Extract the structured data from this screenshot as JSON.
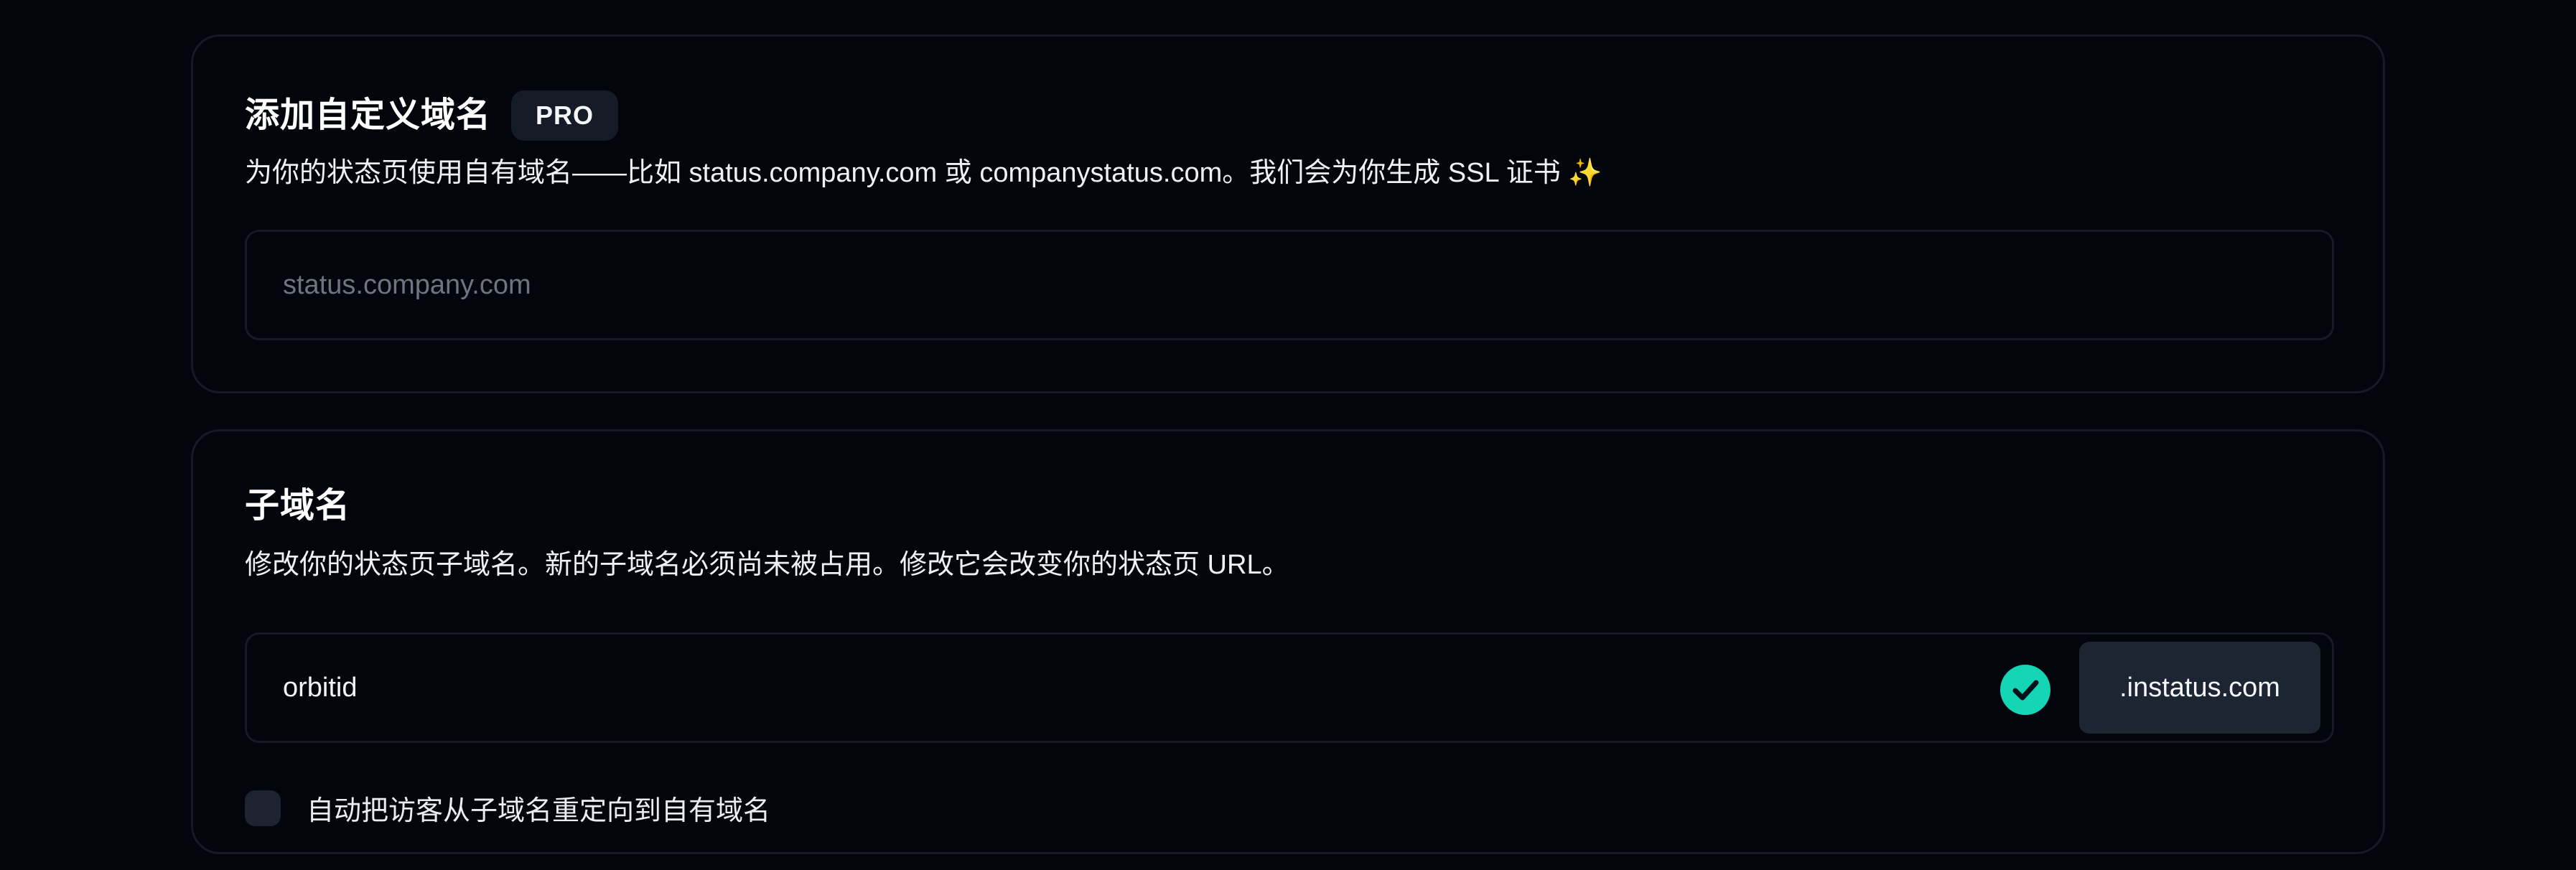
{
  "custom_domain": {
    "title": "添加自定义域名",
    "badge": "PRO",
    "description": "为你的状态页使用自有域名——比如 status.company.com 或 companystatus.com。我们会为你生成 SSL 证书 ✨",
    "input": {
      "value": "",
      "placeholder": "status.company.com"
    }
  },
  "subdomain": {
    "title": "子域名",
    "description": "修改你的状态页子域名。新的子域名必须尚未被占用。修改它会改变你的状态页 URL。",
    "input": {
      "value": "orbitid",
      "placeholder": ""
    },
    "valid_icon": "check-circle-icon",
    "suffix": ".instatus.com",
    "redirect_checkbox": {
      "label": "自动把访客从子域名重定向到自有域名",
      "checked": false
    }
  },
  "colors": {
    "background": "#03050c",
    "border": "#151a26",
    "accent": "#14d6b4",
    "badge_bg": "#151b27",
    "suffix_bg": "#1e2532"
  }
}
